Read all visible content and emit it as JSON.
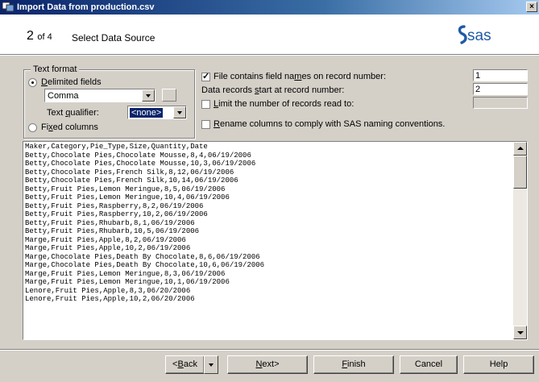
{
  "window": {
    "title": "Import Data from production.csv",
    "close_glyph": "×"
  },
  "header": {
    "step_current": "2",
    "step_of": "of 4",
    "step_title": "Select Data Source",
    "logo_text": "sas"
  },
  "text_format": {
    "group_label": "Text format",
    "delimited_label_pre": "",
    "delimited_label_u": "D",
    "delimited_label_post": "elimited fields",
    "delimiter_value": "Comma",
    "qualifier_label_pre": "Text ",
    "qualifier_label_u": "q",
    "qualifier_label_post": "ualifier:",
    "qualifier_value": "<none>",
    "fixed_label_pre": "Fi",
    "fixed_label_u": "x",
    "fixed_label_post": "ed columns",
    "delimited_selected": true
  },
  "options": {
    "field_names_pre": "File contains field na",
    "field_names_u": "m",
    "field_names_post": "es on record number:",
    "field_names_value": "1",
    "data_start_pre": "Data records ",
    "data_start_u": "s",
    "data_start_post": "tart at record number:",
    "data_start_value": "2",
    "limit_pre": "",
    "limit_u": "L",
    "limit_post": "imit the number of records read to:",
    "limit_value": "",
    "rename_pre": "",
    "rename_u": "R",
    "rename_post": "ename columns to comply with SAS naming conventions."
  },
  "preview_lines": [
    "Maker,Category,Pie_Type,Size,Quantity,Date",
    "Betty,Chocolate Pies,Chocolate Mousse,8,4,06/19/2006",
    "Betty,Chocolate Pies,Chocolate Mousse,10,3,06/19/2006",
    "Betty,Chocolate Pies,French Silk,8,12,06/19/2006",
    "Betty,Chocolate Pies,French Silk,10,14,06/19/2006",
    "Betty,Fruit Pies,Lemon Meringue,8,5,06/19/2006",
    "Betty,Fruit Pies,Lemon Meringue,10,4,06/19/2006",
    "Betty,Fruit Pies,Raspberry,8,2,06/19/2006",
    "Betty,Fruit Pies,Raspberry,10,2,06/19/2006",
    "Betty,Fruit Pies,Rhubarb,8,1,06/19/2006",
    "Betty,Fruit Pies,Rhubarb,10,5,06/19/2006",
    "Marge,Fruit Pies,Apple,8,2,06/19/2006",
    "Marge,Fruit Pies,Apple,10,2,06/19/2006",
    "Marge,Chocolate Pies,Death By Chocolate,8,6,06/19/2006",
    "Marge,Chocolate Pies,Death By Chocolate,10,6,06/19/2006",
    "Marge,Fruit Pies,Lemon Meringue,8,3,06/19/2006",
    "Marge,Fruit Pies,Lemon Meringue,10,1,06/19/2006",
    "Lenore,Fruit Pies,Apple,8,3,06/20/2006",
    "Lenore,Fruit Pies,Apple,10,2,06/20/2006"
  ],
  "buttons": {
    "back_pre": "<",
    "back_u": "B",
    "back_post": "ack",
    "next_u": "N",
    "next_post": "ext>",
    "finish_u": "F",
    "finish_post": "inish",
    "cancel": "Cancel",
    "help": "Help"
  },
  "colors": {
    "titlebar": "#0a246a",
    "selection": "#0a246a",
    "face": "#d4d0c8",
    "sas_blue": "#1f5aa8"
  }
}
